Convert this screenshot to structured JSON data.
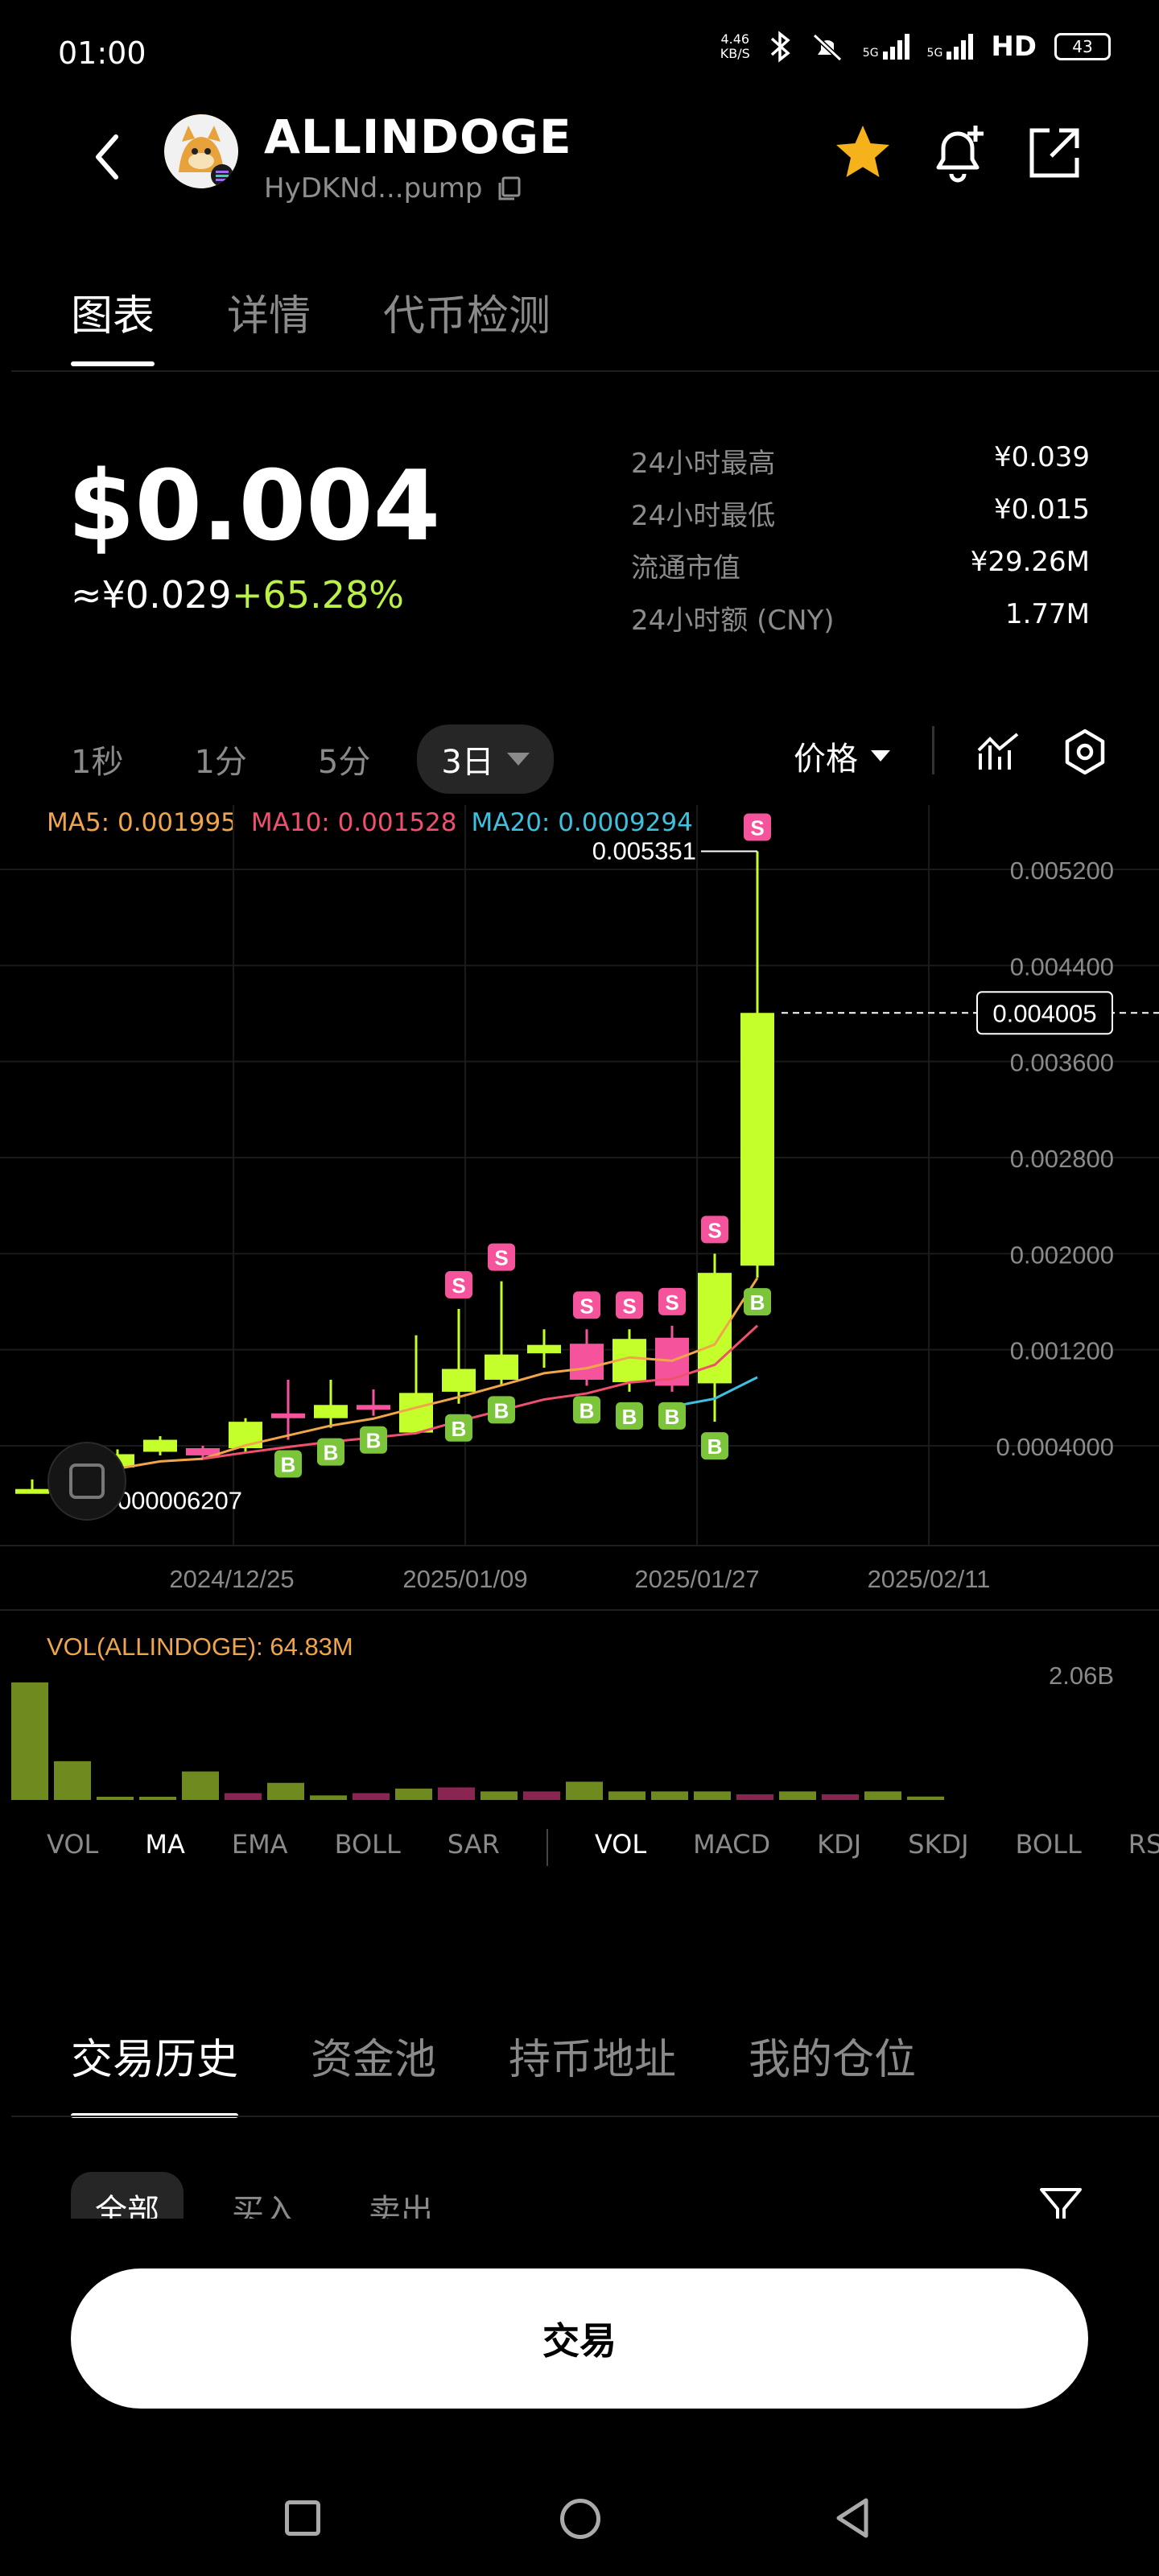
{
  "status_bar": {
    "time": "01:00",
    "net_speed_value": "4.46",
    "net_speed_unit": "KB/S",
    "sim1": "5G",
    "sim2": "5G",
    "hd": "HD",
    "battery": "43"
  },
  "header": {
    "coin_name": "ALLINDOGE",
    "contract": "HyDKNd...pump"
  },
  "tabs": [
    "图表",
    "详情",
    "代币检测"
  ],
  "price": {
    "usd": "$0.004",
    "cny": "≈¥0.029",
    "change": "+65.28%"
  },
  "stats": [
    {
      "label": "24小时最高",
      "value": "¥0.039"
    },
    {
      "label": "24小时最低",
      "value": "¥0.015"
    },
    {
      "label": "流通市值",
      "value": "¥29.26M"
    },
    {
      "label": "24小时额 (CNY)",
      "value": "1.77M"
    }
  ],
  "intervals": [
    "1秒",
    "1分",
    "5分",
    "3日"
  ],
  "price_dropdown": "价格",
  "ma": {
    "ma5": "MA5: 0.001995",
    "ma10": "MA10: 0.001528",
    "ma20": "MA20: 0.0009294"
  },
  "colors": {
    "up": "#c5ff2b",
    "down": "#f5549c",
    "ma5": "#f1a54a",
    "ma10": "#f0506e",
    "ma20": "#3cc2df",
    "gain": "#bbf046"
  },
  "chart_data": {
    "type": "candlestick",
    "y_ticks": [
      "0.005200",
      "0.004400",
      "0.003600",
      "0.002800",
      "0.002000",
      "0.001200",
      "0.0004000"
    ],
    "x_ticks": [
      "2024/12/25",
      "2025/01/09",
      "2025/01/27",
      "2025/02/11"
    ],
    "high_label": "0.005351",
    "low_label": "0.000006207",
    "current_price_label": "0.004005",
    "candles": [
      {
        "o": 2e-05,
        "c": 4e-05,
        "h": 0.00012,
        "l": 6.207e-06,
        "up": true
      },
      {
        "o": 6e-05,
        "c": 0.00026,
        "h": 0.00029,
        "l": 5e-05,
        "up": true
      },
      {
        "o": 0.00022,
        "c": 0.00033,
        "h": 0.00037,
        "l": 0.0002,
        "up": true
      },
      {
        "o": 0.00035,
        "c": 0.00045,
        "h": 0.00048,
        "l": 0.00032,
        "up": true
      },
      {
        "o": 0.00032,
        "c": 0.00038,
        "h": 0.0004,
        "l": 0.0003,
        "up": false
      },
      {
        "o": 0.00038,
        "c": 0.0006,
        "h": 0.00063,
        "l": 0.00035,
        "up": true
      },
      {
        "o": 0.00065,
        "c": 0.00067,
        "h": 0.00095,
        "l": 0.00045,
        "up": false
      },
      {
        "o": 0.00063,
        "c": 0.00074,
        "h": 0.00095,
        "l": 0.00055,
        "up": true
      },
      {
        "o": 0.0007,
        "c": 0.00074,
        "h": 0.00087,
        "l": 0.00065,
        "up": false
      },
      {
        "o": 0.00051,
        "c": 0.00084,
        "h": 0.00132,
        "l": 0.0005,
        "up": true
      },
      {
        "o": 0.00085,
        "c": 0.00104,
        "h": 0.00154,
        "l": 0.00075,
        "up": true
      },
      {
        "o": 0.00095,
        "c": 0.00116,
        "h": 0.00177,
        "l": 0.0009,
        "up": true
      },
      {
        "o": 0.00117,
        "c": 0.00124,
        "h": 0.00137,
        "l": 0.00105,
        "up": true
      },
      {
        "o": 0.00125,
        "c": 0.00095,
        "h": 0.00137,
        "l": 0.0009,
        "up": false
      },
      {
        "o": 0.00093,
        "c": 0.00129,
        "h": 0.00137,
        "l": 0.00085,
        "up": true
      },
      {
        "o": 0.0013,
        "c": 0.0009,
        "h": 0.0014,
        "l": 0.00085,
        "up": false
      },
      {
        "o": 0.00092,
        "c": 0.00184,
        "h": 0.002,
        "l": 0.0006,
        "up": true
      },
      {
        "o": 0.0019,
        "c": 0.004005,
        "h": 0.005351,
        "l": 0.0018,
        "up": true
      }
    ],
    "buy_markers": [
      6,
      7,
      8,
      10,
      11,
      12,
      14,
      15,
      16,
      17,
      18,
      19,
      20,
      21,
      22
    ],
    "sell_markers": [
      10,
      11,
      12,
      14,
      15,
      16,
      17,
      18,
      19,
      21,
      22
    ],
    "volume_label": "VOL(ALLINDOGE): 64.83M",
    "volume_max_label": "2.06B",
    "volumes": [
      {
        "v": 2.06,
        "up": true
      },
      {
        "v": 0.68,
        "up": true
      },
      {
        "v": 0.02,
        "up": true
      },
      {
        "v": 0.05,
        "up": true
      },
      {
        "v": 0.5,
        "up": true
      },
      {
        "v": 0.12,
        "up": false
      },
      {
        "v": 0.3,
        "up": true
      },
      {
        "v": 0.08,
        "up": true
      },
      {
        "v": 0.12,
        "up": false
      },
      {
        "v": 0.2,
        "up": true
      },
      {
        "v": 0.22,
        "up": false
      },
      {
        "v": 0.15,
        "up": true
      },
      {
        "v": 0.15,
        "up": false
      },
      {
        "v": 0.32,
        "up": true
      },
      {
        "v": 0.15,
        "up": true
      },
      {
        "v": 0.15,
        "up": true
      },
      {
        "v": 0.15,
        "up": true
      },
      {
        "v": 0.1,
        "up": false
      },
      {
        "v": 0.15,
        "up": true
      },
      {
        "v": 0.1,
        "up": false
      },
      {
        "v": 0.15,
        "up": true
      },
      {
        "v": 0.06,
        "up": true
      }
    ]
  },
  "indicators_main": [
    "VOL",
    "MA",
    "EMA",
    "BOLL",
    "SAR"
  ],
  "indicators_sub": [
    "VOL",
    "MACD",
    "KDJ",
    "SKDJ",
    "BOLL",
    "RSI"
  ],
  "bottom_tabs": [
    "交易历史",
    "资金池",
    "持币地址",
    "我的仓位"
  ],
  "filters": [
    "全部",
    "买入",
    "卖出"
  ],
  "trade_button": "交易"
}
